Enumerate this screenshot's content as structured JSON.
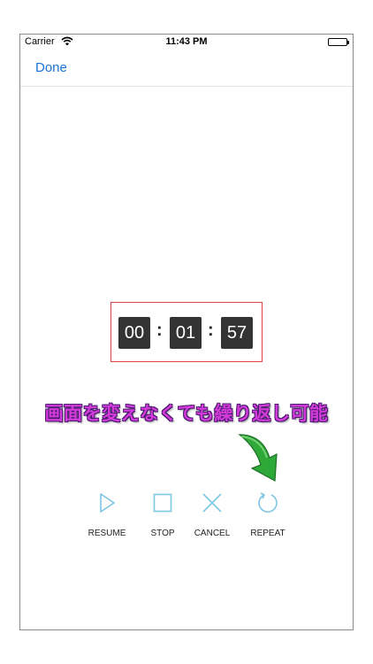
{
  "status_bar": {
    "carrier": "Carrier",
    "time": "11:43 PM"
  },
  "nav": {
    "done_label": "Done"
  },
  "timer": {
    "hours": "00",
    "minutes": "01",
    "seconds": "57",
    "separator": ":"
  },
  "banner": {
    "text": "画面を変えなくても繰り返し可能"
  },
  "controls": [
    {
      "label": "RESUME",
      "icon": "play-icon"
    },
    {
      "label": "STOP",
      "icon": "stop-icon"
    },
    {
      "label": "CANCEL",
      "icon": "close-icon"
    },
    {
      "label": "REPEAT",
      "icon": "repeat-icon"
    }
  ],
  "colors": {
    "accent": "#1a73d6",
    "icon": "#7fc6e4",
    "timer_border": "#e04545",
    "digit_bg": "#333333",
    "banner_text": "#d23ad9",
    "arrow": "#2fa83a"
  }
}
